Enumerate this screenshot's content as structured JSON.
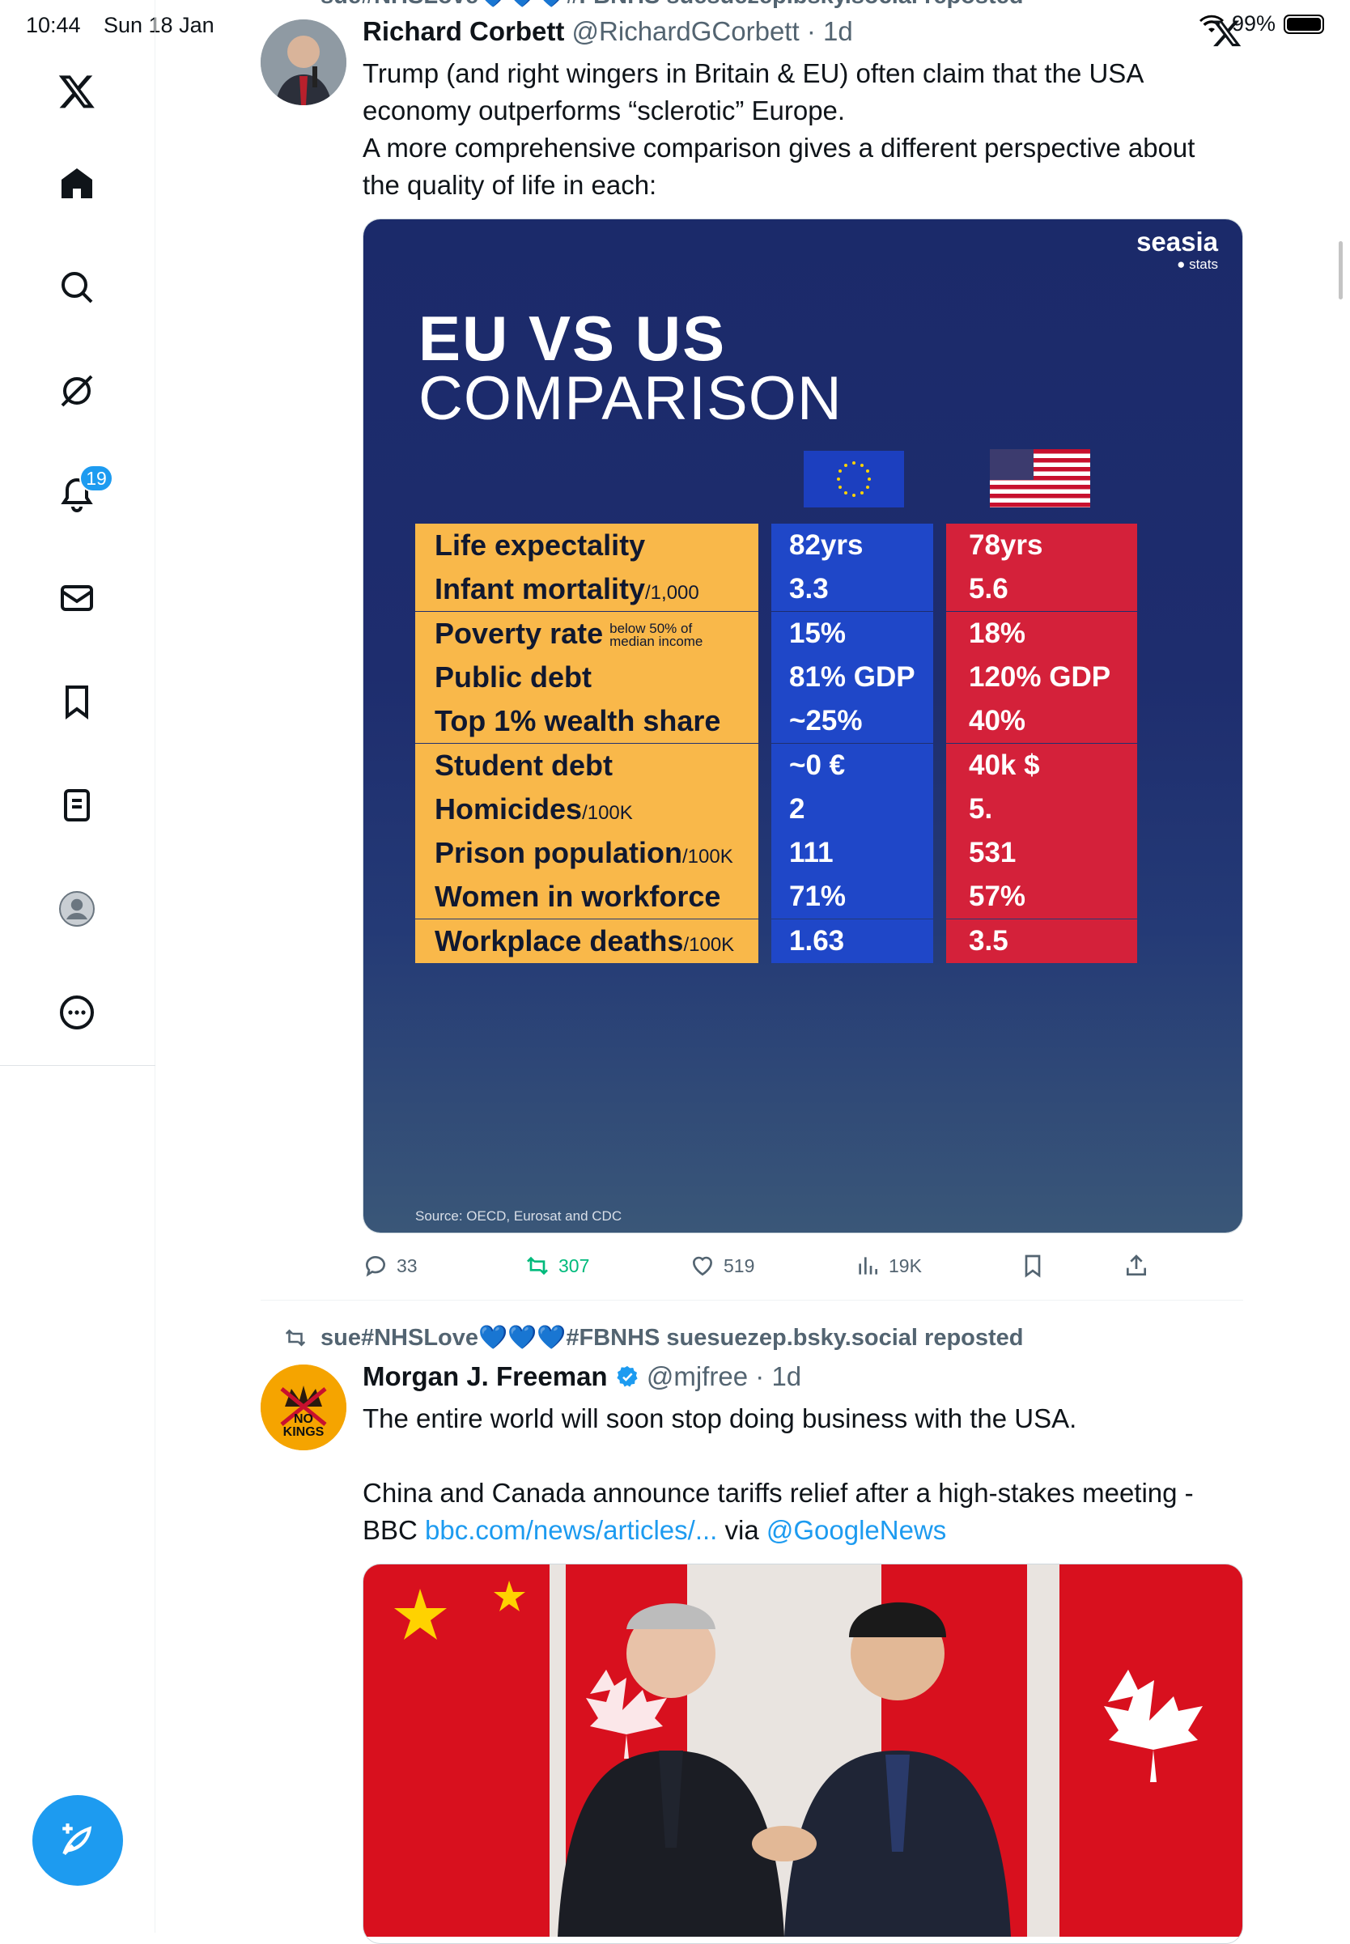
{
  "status_bar": {
    "time": "10:44",
    "date": "Sun 18 Jan",
    "battery": "99%"
  },
  "sidebar": {
    "notifications_badge": "19"
  },
  "tweet1": {
    "repost_partial": "sue#NHSLove💙💙💙#FBNHS suesuezep.bsky.social reposted",
    "name": "Richard Corbett",
    "handle": "@RichardGCorbett",
    "time": "· 1d",
    "text_lines": [
      "Trump (and right wingers in Britain & EU) often claim that the USA",
      "economy outperforms “sclerotic” Europe.",
      "A more comprehensive comparison gives a different perspective about",
      "the quality of life in each:"
    ],
    "infographic": {
      "brand": "seasia",
      "brand_sub": "● stats",
      "title_line1": "EU VS US",
      "title_line2": "COMPARISON",
      "rows": [
        {
          "label": "Life expectality",
          "unit": "",
          "note": "",
          "eu": "82yrs",
          "us": "78yrs"
        },
        {
          "label": "Infant mortality",
          "unit": "/1,000",
          "note": "",
          "eu": "3.3",
          "us": "5.6"
        },
        {
          "label": "Poverty rate",
          "unit": "",
          "note": "below 50% of median income",
          "eu": "15%",
          "us": "18%"
        },
        {
          "label": "Public debt",
          "unit": "",
          "note": "",
          "eu": "81% GDP",
          "us": "120% GDP"
        },
        {
          "label": "Top 1% wealth share",
          "unit": "",
          "note": "",
          "eu": "~25%",
          "us": "40%"
        },
        {
          "label": "Student debt",
          "unit": "",
          "note": "",
          "eu": "~0 €",
          "us": "40k $"
        },
        {
          "label": "Homicides",
          "unit": "/100K",
          "note": "",
          "eu": "2",
          "us": "5."
        },
        {
          "label": "Prison population",
          "unit": "/100K",
          "note": "",
          "eu": "111",
          "us": "531"
        },
        {
          "label": "Women in workforce",
          "unit": "",
          "note": "",
          "eu": "71%",
          "us": "57%"
        },
        {
          "label": "Workplace deaths",
          "unit": "/100K",
          "note": "",
          "eu": "1.63",
          "us": "3.5"
        }
      ],
      "source": "Source: OECD, Eurosat and CDC"
    },
    "stats": {
      "replies": "33",
      "reposts": "307",
      "likes": "519",
      "views": "19K"
    }
  },
  "tweet2": {
    "repost_by": "sue#NHSLove💙💙💙#FBNHS suesuezep.bsky.social reposted",
    "name": "Morgan J. Freeman",
    "handle": "@mjfree",
    "time": "· 1d",
    "line1": "The entire world will soon stop doing business with the USA.",
    "line2": "China and Canada announce tariffs relief after a high-stakes meeting -",
    "line3_prefix": "BBC ",
    "link": "bbc.com/news/articles/...",
    "line3_mid": " via ",
    "mention": "@GoogleNews",
    "avatar_text": "NO KINGS"
  },
  "colors": {
    "accent": "#1d9bf0",
    "repost_green": "#00ba7c",
    "secondary_text": "#536471"
  }
}
